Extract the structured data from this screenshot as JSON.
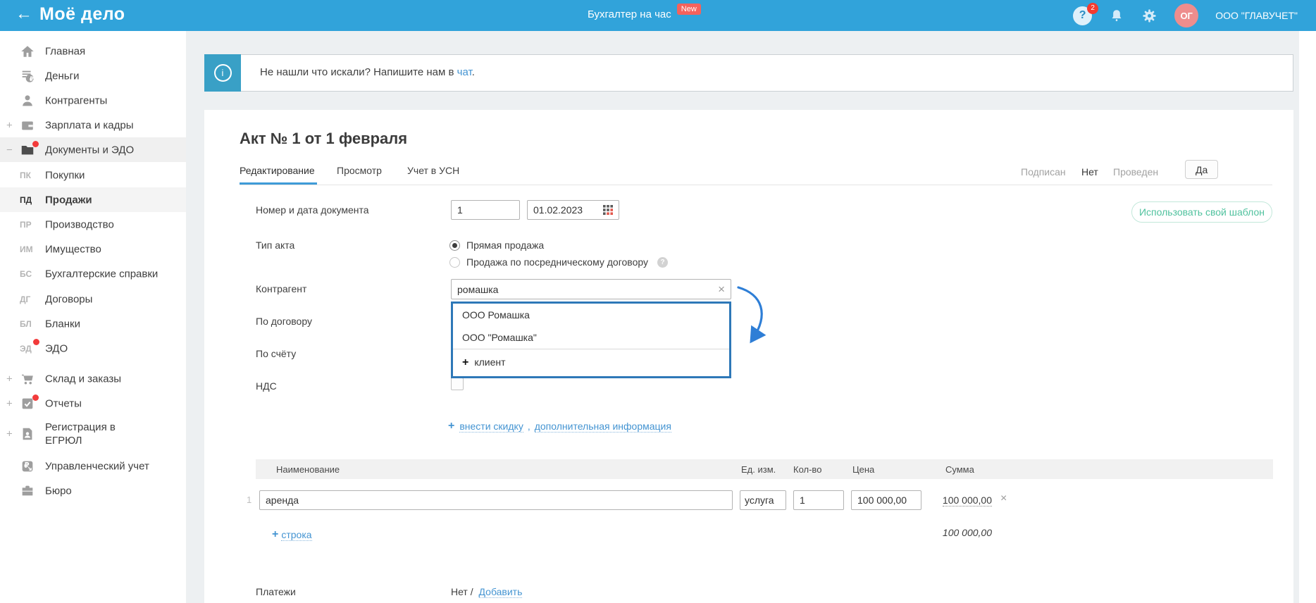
{
  "icons": {
    "back": "←",
    "close": "×",
    "plus": "+",
    "minus": "−",
    "info": "i",
    "question": "?",
    "rub": "₽"
  },
  "header": {
    "logo": "Моё дело",
    "center_link": "Бухгалтер на час",
    "new_badge": "New",
    "help_count": "2",
    "avatar": "ОГ",
    "company": "ООО \"ГЛАВУЧЕТ\""
  },
  "sidebar": {
    "items": [
      {
        "label": "Главная"
      },
      {
        "label": "Деньги"
      },
      {
        "label": "Контрагенты"
      },
      {
        "label": "Зарплата и кадры"
      },
      {
        "label": "Документы и ЭДО"
      },
      {
        "label": "Склад и заказы"
      },
      {
        "label": "Отчеты"
      },
      {
        "label": "Регистрация в ЕГРЮЛ"
      },
      {
        "label": "Управленческий учет"
      },
      {
        "label": "Бюро"
      }
    ],
    "subitems": [
      {
        "code": "ПК",
        "label": "Покупки"
      },
      {
        "code": "ПД",
        "label": "Продажи"
      },
      {
        "code": "ПР",
        "label": "Производство"
      },
      {
        "code": "ИМ",
        "label": "Имущество"
      },
      {
        "code": "БС",
        "label": "Бухгалтерские справки"
      },
      {
        "code": "ДГ",
        "label": "Договоры"
      },
      {
        "code": "БЛ",
        "label": "Бланки"
      },
      {
        "code": "ЭД",
        "label": "ЭДО"
      }
    ]
  },
  "banner": {
    "text": "Не нашли что искали? Напишите нам в",
    "link": "чат",
    "period": "."
  },
  "doc": {
    "title": "Акт № 1 от 1 февраля",
    "tabs": {
      "editing": "Редактирование",
      "preview": "Просмотр",
      "usn": "Учет в УСН"
    },
    "status": {
      "signed_label": "Подписан",
      "signed_value": "Нет",
      "posted_label": "Проведен",
      "posted_value": "Да"
    },
    "template_button": "Использовать свой шаблон",
    "fields": {
      "number_label": "Номер и дата документа",
      "number_value": "1",
      "date_value": "01.02.2023",
      "type_label": "Тип акта",
      "type_option1": "Прямая продажа",
      "type_option2": "Продажа по посредническому договору",
      "contractor_label": "Контрагент",
      "contractor_value": "ромашка",
      "contract_label": "По договору",
      "invoice_label": "По счёту",
      "vat_label": "НДС"
    },
    "dropdown": {
      "option1": "ООО Ромашка",
      "option2": "ООО \"Ромашка\"",
      "add_label": "клиент"
    },
    "links": {
      "discount": "внести скидку",
      "comma": ",",
      "info": "дополнительная информация"
    },
    "table": {
      "headers": {
        "name": "Наименование",
        "unit": "Ед. изм.",
        "qty": "Кол-во",
        "price": "Цена",
        "sum": "Сумма"
      },
      "row": {
        "num": "1",
        "name": "аренда",
        "unit": "услуга",
        "qty": "1",
        "price": "100 000,00",
        "sum": "100 000,00"
      },
      "add_row": "строка",
      "total": "100 000,00"
    },
    "payments": {
      "label": "Платежи",
      "value": "Нет /",
      "link": "Добавить"
    }
  }
}
